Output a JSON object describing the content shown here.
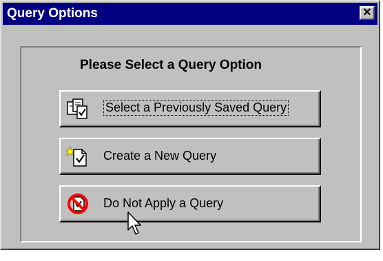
{
  "window": {
    "title": "Query Options",
    "close_icon": "close-icon",
    "close_glyph": "✕"
  },
  "dialog": {
    "heading": "Please Select a Query Option",
    "options": [
      {
        "label": "Select a Previously Saved Query",
        "icon": "saved-queries-icon",
        "focused": true
      },
      {
        "label": "Create a New Query",
        "icon": "new-query-icon",
        "focused": false
      },
      {
        "label": "Do Not Apply a Query",
        "icon": "no-query-icon",
        "focused": false
      }
    ]
  },
  "colors": {
    "titlebar": "#000080",
    "face": "#c0c0c0",
    "shadow": "#808080",
    "highlight": "#ffffff"
  }
}
